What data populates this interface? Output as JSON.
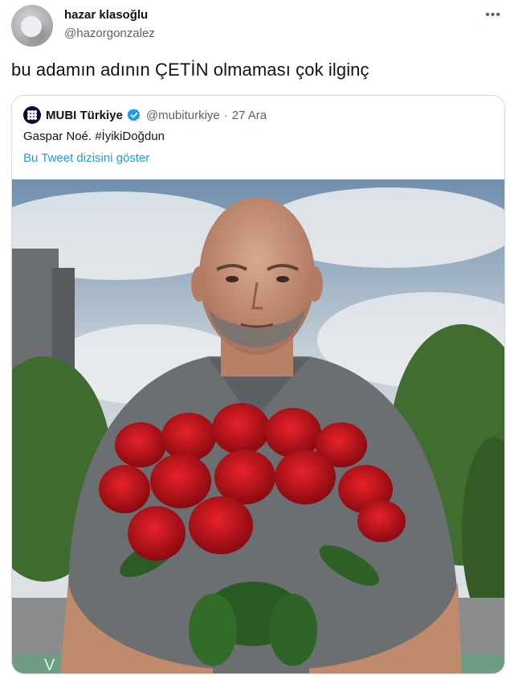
{
  "author": {
    "name": "hazar klasoğlu",
    "handle": "@hazorgonzalez"
  },
  "more_icon": "more-horizontal-icon",
  "tweet_text": "bu adamın adının ÇETİN olmaması çok ilginç",
  "quoted": {
    "name": "MUBI Türkiye",
    "verified": true,
    "handle": "@mubiturkiye",
    "separator": "·",
    "date": "27 Ara",
    "text": "Gaspar Noé. #İyikiDoğdun",
    "thread_link": "Bu Tweet dizisini göster",
    "image_alt_icon": "photo"
  },
  "colors": {
    "link": "#1d9bf0",
    "secondary_text": "#536471",
    "border": "#cfd9de"
  }
}
